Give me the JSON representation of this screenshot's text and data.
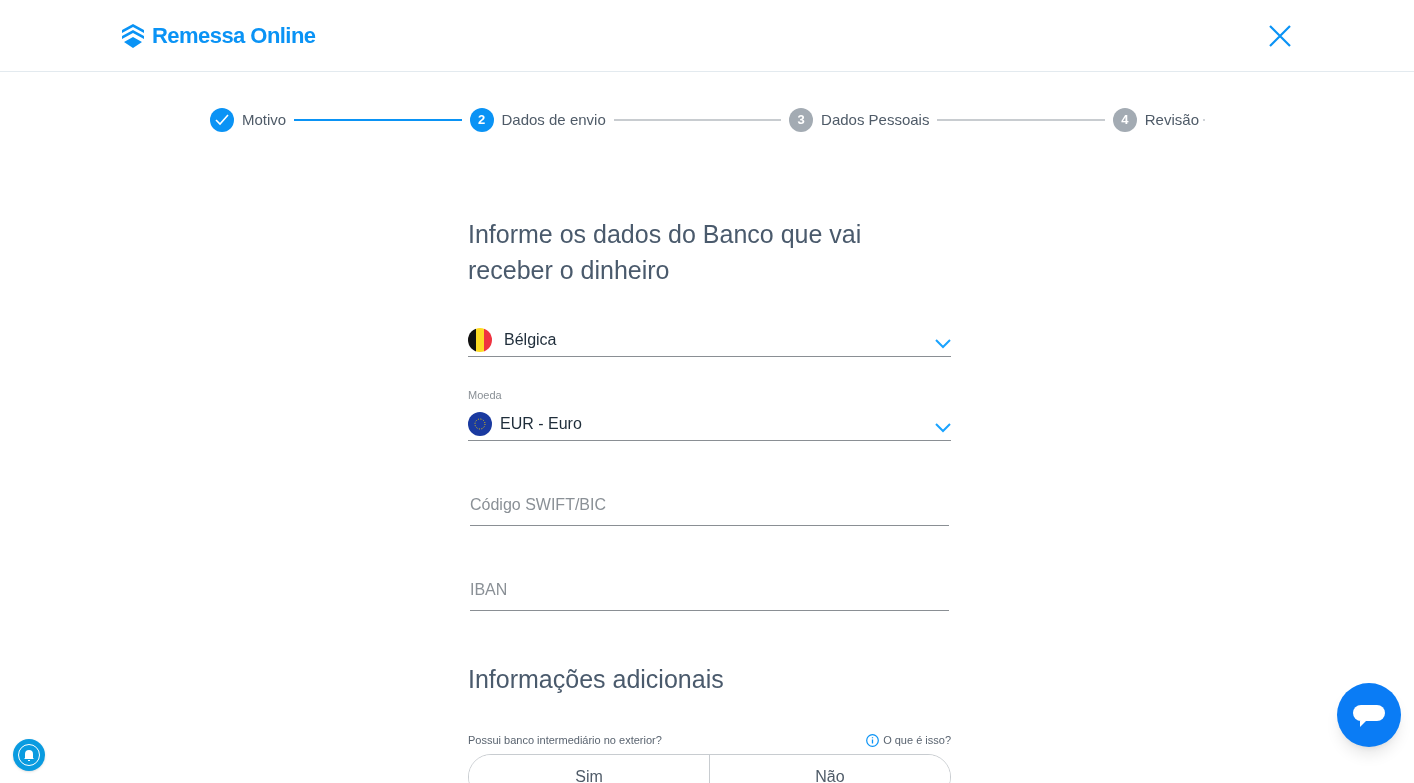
{
  "header": {
    "logo": "Remessa Online"
  },
  "steps": [
    {
      "label": "Motivo",
      "kind": "done"
    },
    {
      "marker": "2",
      "label": "Dados de envio",
      "kind": "current"
    },
    {
      "marker": "3",
      "label": "Dados Pessoais",
      "kind": "upcoming"
    },
    {
      "marker": "4",
      "label": "Revisão",
      "kind": "upcoming"
    }
  ],
  "form": {
    "heading": "Informe os dados do Banco que vai receber o dinheiro",
    "country": {
      "value": "Bélgica"
    },
    "currency": {
      "label": "Moeda",
      "value": "EUR - Euro"
    },
    "swift": {
      "placeholder": "Código SWIFT/BIC"
    },
    "iban": {
      "placeholder": "IBAN"
    },
    "additional_heading": "Informações adicionais",
    "intermediary": {
      "question": "Possui banco intermediário no exterior?",
      "help": "O que é isso?",
      "options": [
        {
          "label": "Sim",
          "selected": false
        },
        {
          "label": "Não",
          "selected": false
        }
      ]
    }
  }
}
